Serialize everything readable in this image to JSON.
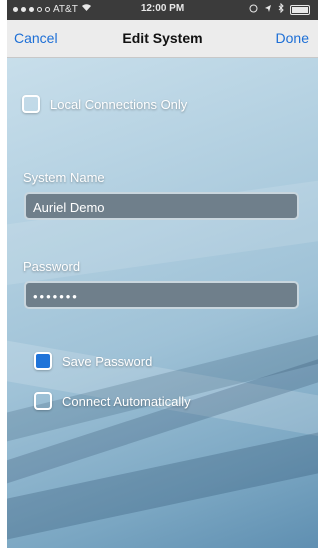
{
  "status_bar": {
    "carrier": "AT&T",
    "time": "12:00 PM"
  },
  "nav": {
    "left_label": "Cancel",
    "title": "Edit System",
    "right_label": "Done"
  },
  "form": {
    "local_only": {
      "label": "Local Connections Only",
      "checked": false
    },
    "system_name": {
      "label": "System Name",
      "value": "Auriel Demo"
    },
    "password": {
      "label": "Password",
      "value": "•••••••"
    },
    "save_password": {
      "label": "Save Password",
      "checked": true
    },
    "connect_auto": {
      "label": "Connect Automatically",
      "checked": false
    }
  },
  "colors": {
    "accent": "#1d6fd6",
    "checkbox_checked": "#1f74d9"
  }
}
